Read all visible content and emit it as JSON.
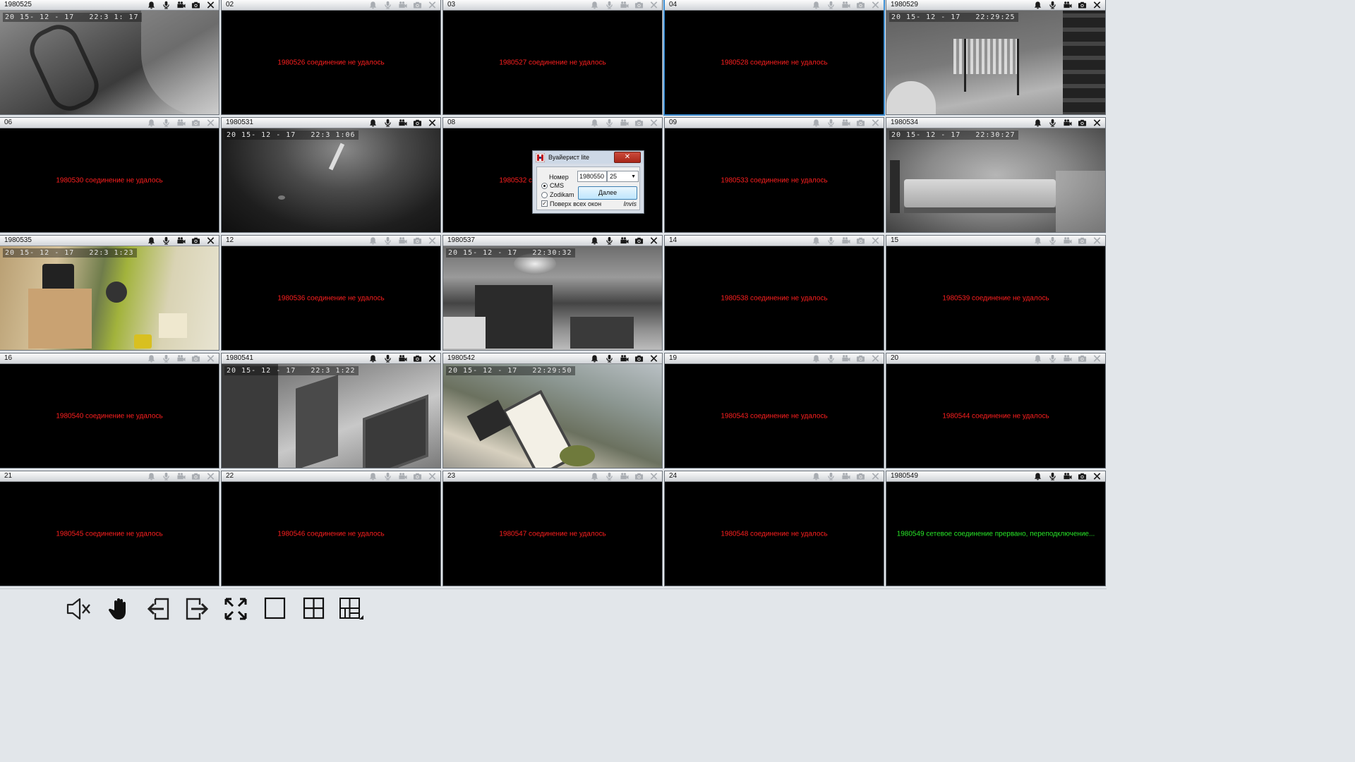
{
  "tiles": [
    {
      "title": "1980525",
      "active": true,
      "scene": true,
      "osd": "20 15- 12 - 17   22:3 1: 17"
    },
    {
      "title": "02",
      "active": false,
      "message": "1980526 соединение не удалось"
    },
    {
      "title": "03",
      "active": false,
      "message": "1980527 соединение не удалось"
    },
    {
      "title": "04",
      "active": false,
      "selected": true,
      "message": "1980528 соединение не удалось"
    },
    {
      "title": "1980529",
      "active": true,
      "scene": true,
      "osd": "20 15- 12 - 17   22:29:25"
    },
    {
      "title": "06",
      "active": false,
      "message": "1980530 соединение не удалось"
    },
    {
      "title": "1980531",
      "active": true,
      "scene": true,
      "osd": "20 15- 12 - 17   22:3 1:06"
    },
    {
      "title": "08",
      "active": false,
      "message": "1980532 соединение не удалось"
    },
    {
      "title": "09",
      "active": false,
      "message": "1980533 соединение не удалось"
    },
    {
      "title": "1980534",
      "active": true,
      "scene": true,
      "osd": "20 15- 12 - 17   22:30:27"
    },
    {
      "title": "1980535",
      "active": true,
      "scene": true,
      "osd": "20 15- 12 - 17   22:3 1:23"
    },
    {
      "title": "12",
      "active": false,
      "message": "1980536 соединение не удалось"
    },
    {
      "title": "1980537",
      "active": true,
      "scene": true,
      "osd": "20 15- 12 - 17   22:30:32"
    },
    {
      "title": "14",
      "active": false,
      "message": "1980538 соединение не удалось"
    },
    {
      "title": "15",
      "active": false,
      "message": "1980539 соединение не удалось"
    },
    {
      "title": "16",
      "active": false,
      "message": "1980540 соединение не удалось"
    },
    {
      "title": "1980541",
      "active": true,
      "scene": true,
      "osd": "20 15- 12 - 17   22:3 1:22"
    },
    {
      "title": "1980542",
      "active": true,
      "scene": true,
      "osd": "20 15- 12 - 17   22:29:50"
    },
    {
      "title": "19",
      "active": false,
      "message": "1980543 соединение не удалось"
    },
    {
      "title": "20",
      "active": false,
      "message": "1980544 соединение не удалось"
    },
    {
      "title": "21",
      "active": false,
      "message": "1980545 соединение не удалось"
    },
    {
      "title": "22",
      "active": false,
      "message": "1980546 соединение не удалось"
    },
    {
      "title": "23",
      "active": false,
      "message": "1980547 соединение не удалось"
    },
    {
      "title": "24",
      "active": false,
      "message": "1980548 соединение не удалось"
    },
    {
      "title": "1980549",
      "active": true,
      "message": "1980549 сетевое соединение прервано, переподключение...",
      "message_color": "green"
    }
  ],
  "tile_icons": [
    "alarm-bell-icon",
    "microphone-icon",
    "record-camera-icon",
    "snapshot-camera-icon",
    "close-icon"
  ],
  "colors": {
    "error_text": "#ff1f1f",
    "reconnect_text": "#28e628",
    "selected_border": "#3c8ed3"
  },
  "toolbar": {
    "buttons": [
      "mute-speaker-icon",
      "hand-pan-icon",
      "import-icon",
      "export-icon",
      "fullscreen-icon",
      "layout-1x1-icon",
      "layout-2x2-icon",
      "layout-custom-icon"
    ]
  },
  "dialog": {
    "title": "Вуайерист lite",
    "close_label": "✕",
    "number_label": "Номер",
    "number_value": "1980550",
    "count_value": "25",
    "radio_options": [
      "CMS",
      "Zodikam"
    ],
    "radio_selected": "CMS",
    "next_label": "Далее",
    "always_on_top_label": "Поверх всех окон",
    "always_on_top_checked": true,
    "invis_label": "Invis"
  }
}
